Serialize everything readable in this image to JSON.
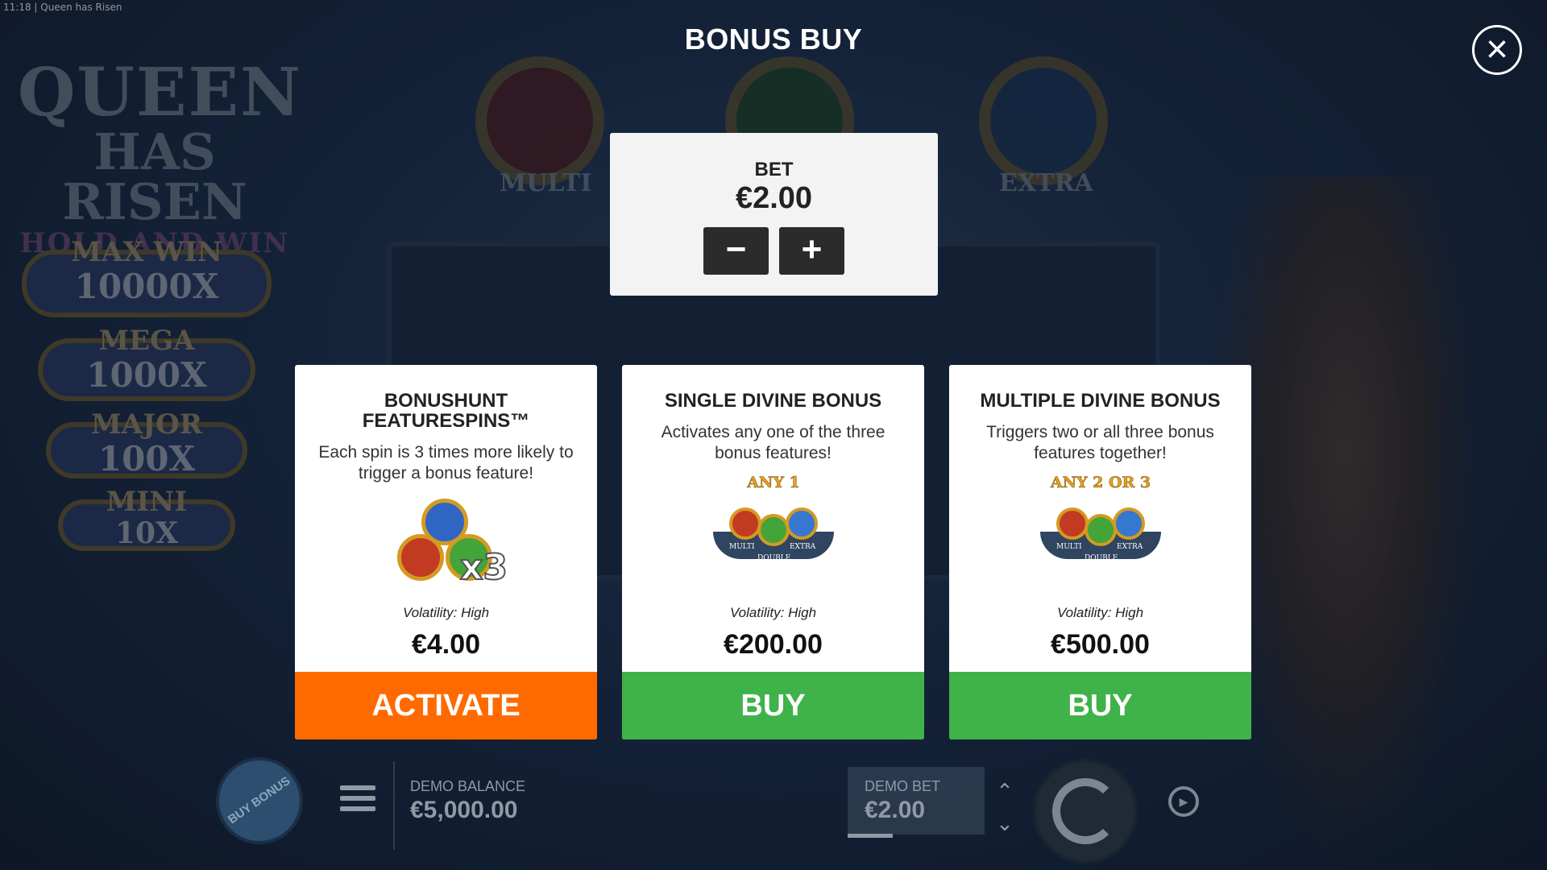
{
  "window": {
    "time": "11:18",
    "title": "Queen has Risen"
  },
  "game": {
    "logo": {
      "line1": "QUEEN",
      "line2": "HAS RISEN",
      "line3": "HOLD AND WIN"
    },
    "jackpots": [
      {
        "name": "MAX WIN",
        "multiplier": "10000X"
      },
      {
        "name": "MEGA",
        "multiplier": "1000X"
      },
      {
        "name": "MAJOR",
        "multiplier": "100X"
      },
      {
        "name": "MINI",
        "multiplier": "10X"
      }
    ],
    "medallions": {
      "left": "MULTI",
      "right": "EXTRA"
    }
  },
  "overlay": {
    "title": "BONUS BUY",
    "bet": {
      "label": "BET",
      "value": "€2.00",
      "decrease": "−",
      "increase": "+"
    },
    "cards": [
      {
        "title": "BONUSHUNT FEATURESPINS™",
        "description": "Each spin is 3 times more likely to trigger a bonus feature!",
        "art_badge": "x3",
        "volatility": "Volatility: High",
        "price": "€4.00",
        "button": "ACTIVATE"
      },
      {
        "title": "SINGLE DIVINE BONUS",
        "description": "Activates any one of the three bonus features!",
        "art_badge": "ANY 1",
        "volatility": "Volatility: High",
        "price": "€200.00",
        "button": "BUY"
      },
      {
        "title": "MULTIPLE DIVINE BONUS",
        "description": "Triggers two or all three bonus features together!",
        "art_badge": "ANY 2 OR 3",
        "volatility": "Volatility: High",
        "price": "€500.00",
        "button": "BUY"
      }
    ],
    "art_labels": {
      "multi": "MULTI",
      "extra": "EXTRA",
      "double": "DOUBLE"
    }
  },
  "bottom_bar": {
    "buy_bonus": "BUY BONUS",
    "demo_balance_label": "DEMO BALANCE",
    "demo_balance_value": "€5,000.00",
    "demo_bet_label": "DEMO BET",
    "demo_bet_value": "€2.00"
  },
  "colors": {
    "activate": "#ff6a00",
    "buy": "#3fb24a",
    "card_bg": "#ffffff",
    "bet_box_bg": "#f3f3f3"
  },
  "icons": [
    "close-icon",
    "minus-icon",
    "plus-icon",
    "menu-icon",
    "spin-icon",
    "autoplay-icon",
    "arrow-up-icon",
    "arrow-down-icon"
  ]
}
